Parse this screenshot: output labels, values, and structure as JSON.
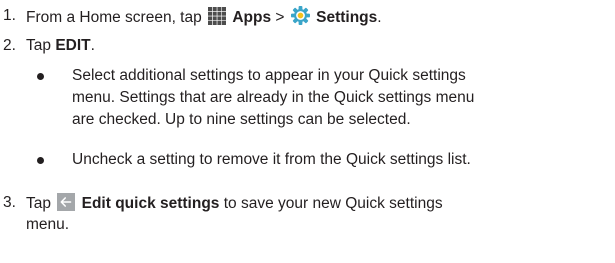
{
  "steps": [
    {
      "number": "1.",
      "prefix": "From a Home screen, tap",
      "apps_icon": "apps-grid-icon",
      "apps_label": "Apps",
      "separator": ">",
      "settings_icon": "settings-gear-icon",
      "settings_label": "Settings",
      "suffix": "."
    },
    {
      "number": "2.",
      "prefix": "Tap",
      "bold": "EDIT",
      "suffix": ".",
      "bullets": [
        {
          "lines": [
            "Select additional settings to appear in your Quick settings",
            "menu. Settings that are already in the Quick settings menu",
            "are checked. Up to nine settings can be selected."
          ]
        },
        {
          "lines": [
            "Uncheck a setting to remove it from the Quick settings list."
          ]
        }
      ]
    },
    {
      "number": "3.",
      "prefix": "Tap",
      "back_icon": "back-arrow-icon",
      "bold": "Edit quick settings",
      "suffix": "to save your new Quick settings",
      "line2": "menu."
    }
  ],
  "colors": {
    "text": "#231f20",
    "apps_icon": "#4d4d4d",
    "settings_icon": "#3aa5c9",
    "back_icon_bg": "#a4a7aa"
  }
}
